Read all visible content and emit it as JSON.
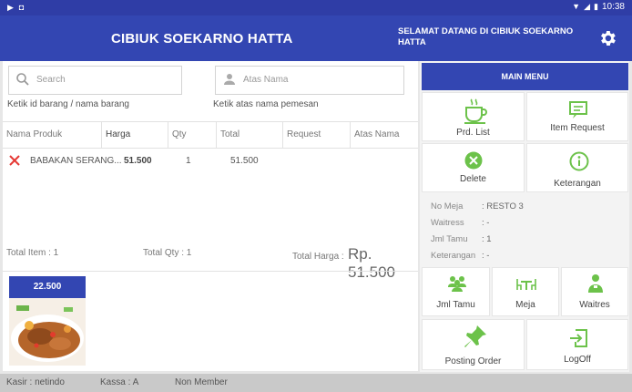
{
  "status": {
    "time": "10:38"
  },
  "header": {
    "title": "CIBIUK SOEKARNO HATTA",
    "welcome": "SELAMAT DATANG DI CIBIUK SOEKARNO HATTA",
    "settings_icon": "gear-icon"
  },
  "search": {
    "placeholder": "Search",
    "hint": "Ketik id barang / nama barang"
  },
  "customer": {
    "placeholder": "Atas Nama",
    "hint": "Ketik atas nama pemesan"
  },
  "table": {
    "headers": [
      "Nama Produk",
      "Harga",
      "Qty",
      "Total",
      "Request",
      "Atas Nama"
    ],
    "rows": [
      {
        "name": "BABAKAN SERANG...",
        "price": "51.500",
        "qty": "1",
        "total": "51.500",
        "request": "",
        "atas_nama": ""
      }
    ]
  },
  "totals": {
    "item": "Total Item : 1",
    "qty": "Total Qty : 1",
    "price_label": "Total Harga :",
    "price_value": "Rp. 51.500"
  },
  "products": [
    {
      "price": "22.500"
    }
  ],
  "footer": {
    "kasir": "Kasir : netindo",
    "kassa": "Kassa : A",
    "member": "Non Member"
  },
  "menu": {
    "title": "MAIN MENU",
    "prd_list": "Prd. List",
    "item_request": "Item Request",
    "delete": "Delete",
    "keterangan": "Keterangan",
    "jml_tamu": "Jml Tamu",
    "meja": "Meja",
    "waitres": "Waitres",
    "posting_order": "Posting Order",
    "logoff": "LogOff"
  },
  "info": {
    "no_meja_label": "No Meja",
    "no_meja_value": ": RESTO 3",
    "waitress_label": "Waitress",
    "waitress_value": ": -",
    "jml_tamu_label": "Jml Tamu",
    "jml_tamu_value": ": 1",
    "keterangan_label": "Keterangan",
    "keterangan_value": ": -"
  },
  "colors": {
    "primary": "#3346b2",
    "accent_green": "#6cc24a",
    "danger": "#e53935"
  }
}
